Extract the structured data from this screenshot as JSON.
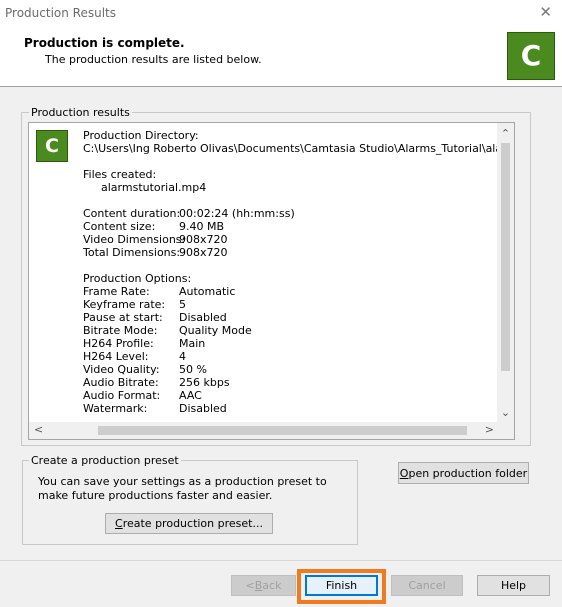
{
  "window": {
    "title": "Production Results",
    "close_glyph": "✕"
  },
  "header": {
    "heading": "Production is complete.",
    "subheading": "The production results are listed below.",
    "logo_letter": "C",
    "logo_color": "#4b8a1e"
  },
  "results": {
    "group_label": "Production results",
    "directory_label": "Production Directory:",
    "directory_path": "C:\\Users\\Ing Roberto Olivas\\Documents\\Camtasia Studio\\Alarms_Tutorial\\alarmstutorial",
    "files_label": "Files created:",
    "file_name": "alarmstutorial.mp4",
    "stats": [
      {
        "label": "Content duration:",
        "value": "00:02:24 (hh:mm:ss)"
      },
      {
        "label": "Content size:",
        "value": "9.40 MB"
      },
      {
        "label": "Video Dimensions:",
        "value": "908x720"
      },
      {
        "label": "Total Dimensions:",
        "value": "908x720"
      }
    ],
    "options_label": "Production Options:",
    "options": [
      {
        "label": "Frame Rate:",
        "value": "Automatic"
      },
      {
        "label": "Keyframe rate:",
        "value": "5"
      },
      {
        "label": "Pause at start:",
        "value": "Disabled"
      },
      {
        "label": "Bitrate Mode:",
        "value": "Quality Mode"
      },
      {
        "label": "H264 Profile:",
        "value": "Main"
      },
      {
        "label": "H264 Level:",
        "value": "4"
      },
      {
        "label": "Video Quality:",
        "value": "50 %"
      },
      {
        "label": "Audio Bitrate:",
        "value": "256 kbps"
      },
      {
        "label": "Audio Format:",
        "value": "AAC"
      },
      {
        "label": "Watermark:",
        "value": "Disabled"
      }
    ]
  },
  "preset": {
    "group_label": "Create a production preset",
    "description": "You can save your settings as a production preset to make future productions faster and easier.",
    "button_mnemonic": "C",
    "button_rest": "reate production preset..."
  },
  "open_folder": {
    "mnemonic": "O",
    "rest": "pen production folder"
  },
  "footer": {
    "back_prefix": "< ",
    "back_mnemonic": "B",
    "back_rest": "ack",
    "finish_label": "Finish",
    "cancel_label": "Cancel",
    "help_label": "Help",
    "highlight_color": "#f07a20"
  }
}
